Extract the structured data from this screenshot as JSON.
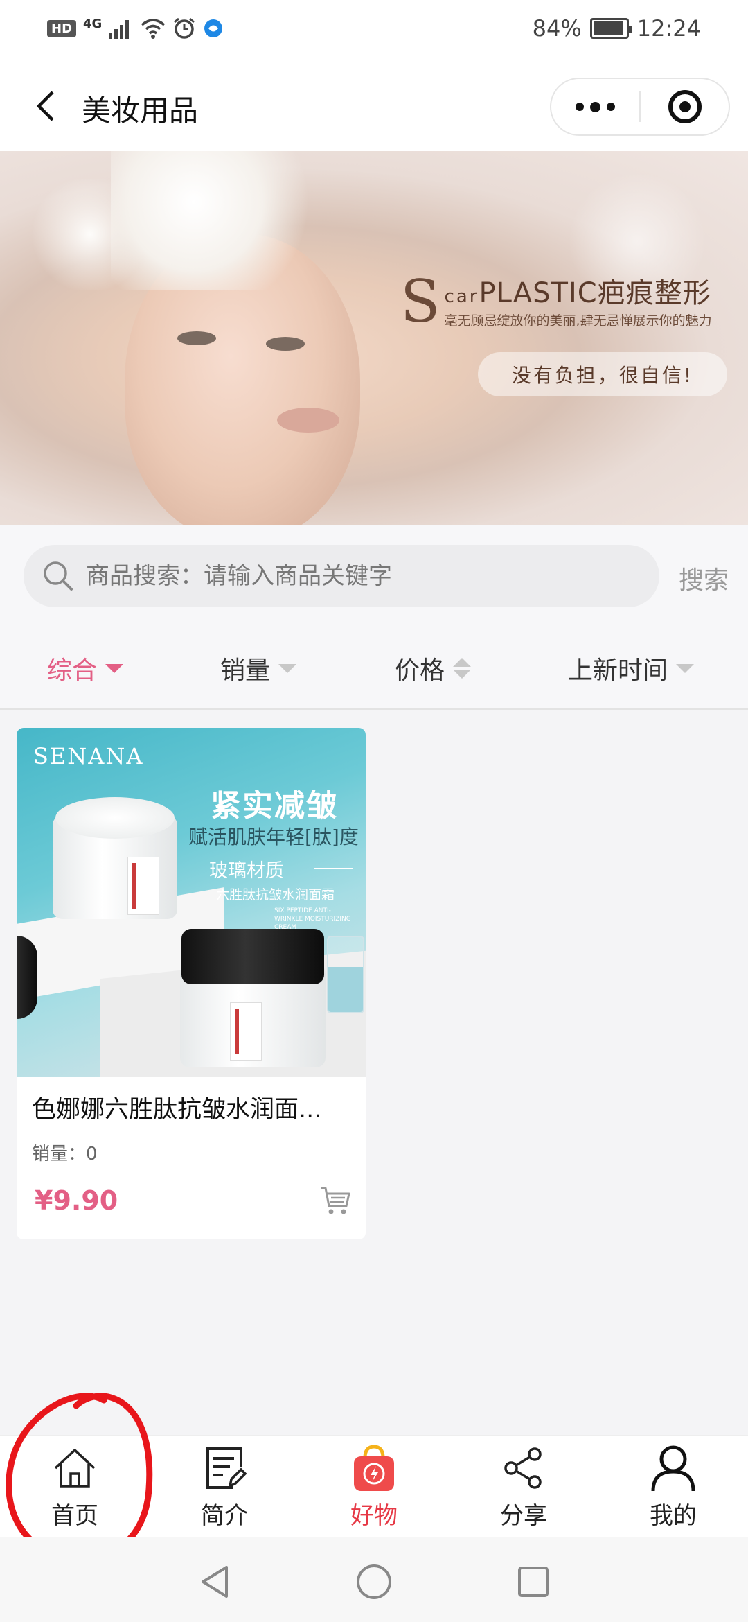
{
  "status_bar": {
    "hd": "HD",
    "network": "4G",
    "battery": "84%",
    "battery_level": 0.84,
    "time": "12:24"
  },
  "nav": {
    "title": "美妆用品"
  },
  "banner": {
    "brand_s": "S",
    "brand_title_small": "car",
    "brand_title": "PLASTIC疤痕整形",
    "brand_sub": "毫无顾忌绽放你的美丽,肆无忌惮展示你的魅力",
    "tagline": "没有负担，很自信!"
  },
  "search": {
    "placeholder": "商品搜索：请输入商品关键字",
    "button": "搜索"
  },
  "sort": {
    "items": [
      {
        "label": "综合"
      },
      {
        "label": "销量"
      },
      {
        "label": "价格"
      },
      {
        "label": "上新时间"
      }
    ],
    "active_color": "#e35f85"
  },
  "products": [
    {
      "image": {
        "brand": "SENANA",
        "title": "紧实减皱",
        "subtitle": "赋活肌肤年轻[肽]度",
        "material": "玻璃材质",
        "desc": "六胜肽抗皱水润面霜",
        "desc_en": "SIX PEPTIDE ANTI-WRINKLE MOISTURIZING CREAM"
      },
      "name": "色娜娜六胜肽抗皱水润面...",
      "sales": "销量：0",
      "price": "¥9.90"
    }
  ],
  "tabbar": {
    "items": [
      {
        "label": "首页",
        "icon": "home-icon"
      },
      {
        "label": "简介",
        "icon": "document-edit-icon"
      },
      {
        "label": "好物",
        "icon": "shopping-bag-icon"
      },
      {
        "label": "分享",
        "icon": "share-icon"
      },
      {
        "label": "我的",
        "icon": "user-icon"
      }
    ],
    "active_color": "#e63845"
  },
  "colors": {
    "accent_pink": "#e35f85",
    "tab_active": "#e63845",
    "annotation": "#e8161b"
  }
}
